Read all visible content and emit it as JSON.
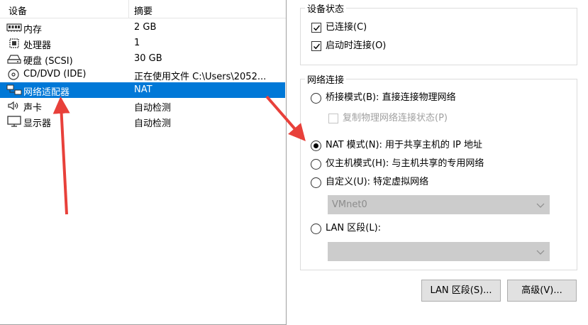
{
  "device_list": {
    "col_device": "设备",
    "col_summary": "摘要",
    "rows": [
      {
        "icon": "memory-icon",
        "name": "内存",
        "summary": "2 GB",
        "selected": false
      },
      {
        "icon": "processor-icon",
        "name": "处理器",
        "summary": "1",
        "selected": false
      },
      {
        "icon": "hard-disk-icon",
        "name": "硬盘 (SCSI)",
        "summary": "30 GB",
        "selected": false
      },
      {
        "icon": "cd-dvd-icon",
        "name": "CD/DVD (IDE)",
        "summary": "正在使用文件 C:\\Users\\2052...",
        "selected": false
      },
      {
        "icon": "network-adapter-icon",
        "name": "网络适配器",
        "summary": "NAT",
        "selected": true
      },
      {
        "icon": "sound-card-icon",
        "name": "声卡",
        "summary": "自动检测",
        "selected": false
      },
      {
        "icon": "display-icon",
        "name": "显示器",
        "summary": "自动检测",
        "selected": false
      }
    ]
  },
  "device_status": {
    "title": "设备状态",
    "connected_label": "已连接(C)",
    "connected": true,
    "connect_at_power_on_label": "启动时连接(O)",
    "connect_at_power_on": true
  },
  "network_connection": {
    "title": "网络连接",
    "bridged_label": "桥接模式(B): 直接连接物理网络",
    "replicate_label": "复制物理网络连接状态(P)",
    "replicate_checked": false,
    "nat_label": "NAT 模式(N): 用于共享主机的 IP 地址",
    "host_only_label": "仅主机模式(H): 与主机共享的专用网络",
    "custom_label": "自定义(U): 特定虚拟网络",
    "custom_select_value": "VMnet0",
    "lan_segment_label": "LAN 区段(L):",
    "lan_segment_select_value": "",
    "selected_mode": "nat"
  },
  "buttons": {
    "lan_segments": "LAN 区段(S)...",
    "advanced": "高级(V)..."
  },
  "colors": {
    "selection": "#0078d7",
    "annotation_arrow": "#e8403a",
    "disabled_select": "#cccccc"
  }
}
